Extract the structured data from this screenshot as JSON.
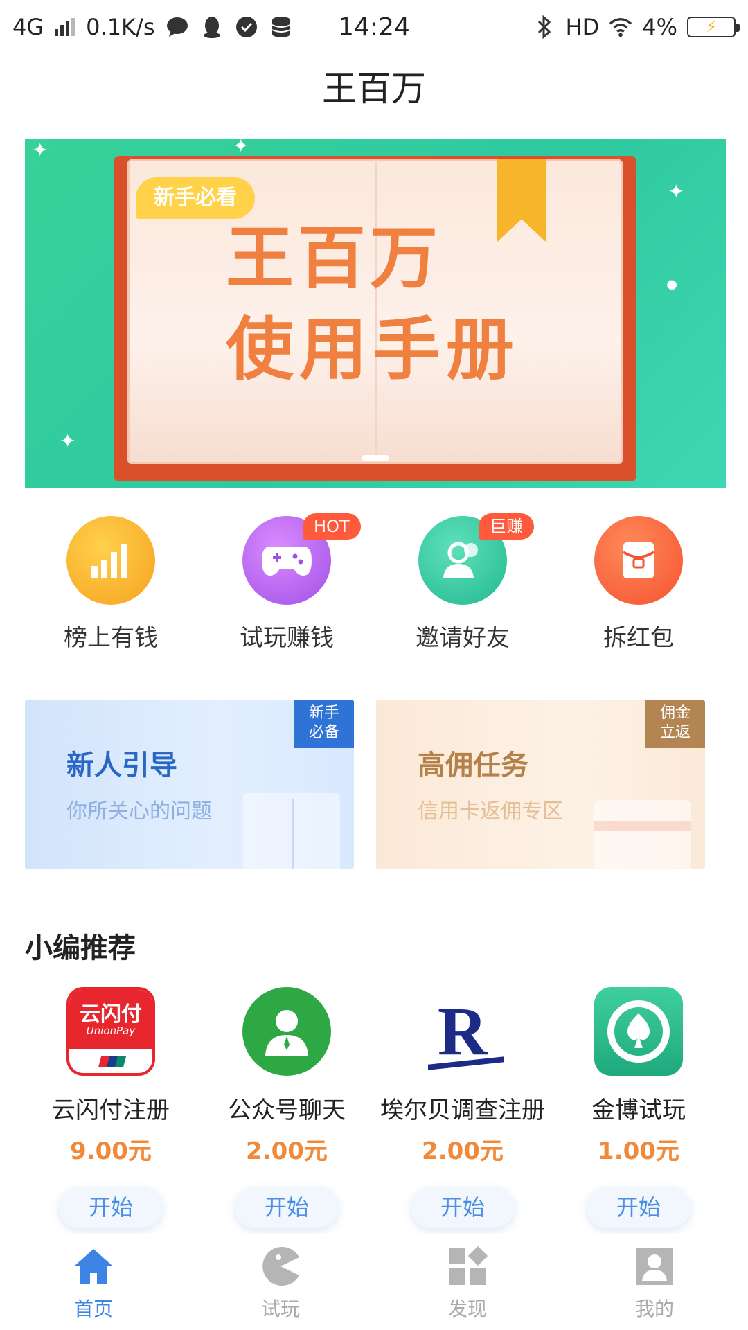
{
  "status_bar": {
    "network": "4G",
    "speed": "0.1K/s",
    "time": "14:24",
    "hd": "HD",
    "battery": "4%"
  },
  "header": {
    "title": "王百万"
  },
  "banner": {
    "tag": "新手必看",
    "title_line1": "王百万",
    "title_line2": "使用手册"
  },
  "quick_actions": [
    {
      "label": "榜上有钱",
      "icon": "bar-chart-icon",
      "color": "#f7b733",
      "badge": ""
    },
    {
      "label": "试玩赚钱",
      "icon": "gamepad-icon",
      "color": "#b86cf0",
      "badge": "HOT"
    },
    {
      "label": "邀请好友",
      "icon": "users-icon",
      "color": "#32c7a0",
      "badge": "巨赚"
    },
    {
      "label": "拆红包",
      "icon": "red-packet-icon",
      "color": "#ff6a4a",
      "badge": ""
    }
  ],
  "promo_cards": [
    {
      "title": "新人引导",
      "subtitle": "你所关心的问题",
      "corner": [
        "新手",
        "必备"
      ]
    },
    {
      "title": "高佣任务",
      "subtitle": "信用卡返佣专区",
      "corner": [
        "佣金",
        "立返"
      ]
    }
  ],
  "recommend": {
    "title": "小编推荐",
    "items": [
      {
        "name": "云闪付注册",
        "price": "9.00元",
        "button": "开始",
        "logo_text": "云闪付",
        "logo_sub": "UnionPay"
      },
      {
        "name": "公众号聊天",
        "price": "2.00元",
        "button": "开始"
      },
      {
        "name": "埃尔贝调查注册",
        "price": "2.00元",
        "button": "开始",
        "logo_text": "R"
      },
      {
        "name": "金博试玩",
        "price": "1.00元",
        "button": "开始"
      }
    ]
  },
  "tabbar": [
    {
      "label": "首页",
      "icon": "home-icon",
      "active": true
    },
    {
      "label": "试玩",
      "icon": "pacman-icon",
      "active": false
    },
    {
      "label": "发现",
      "icon": "discover-icon",
      "active": false
    },
    {
      "label": "我的",
      "icon": "profile-icon",
      "active": false
    }
  ],
  "colors": {
    "accent": "#3d84e6",
    "price": "#f08a3a",
    "banner_bg": "#37d29a"
  }
}
